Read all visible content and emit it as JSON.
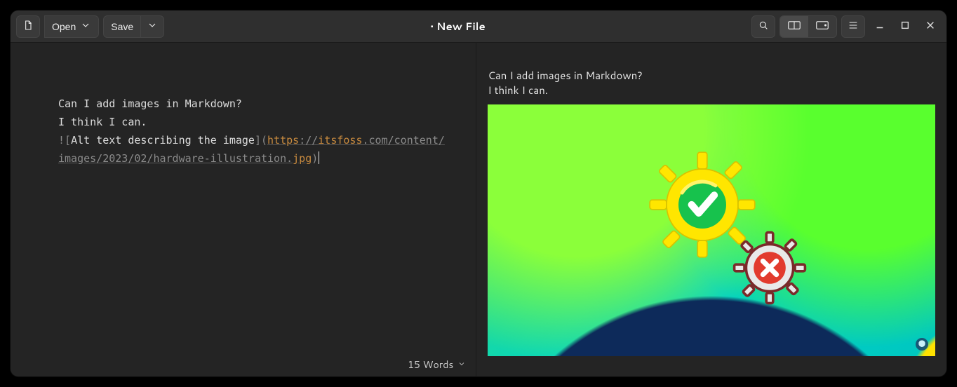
{
  "header": {
    "title": "• New File",
    "open_label": "Open",
    "save_label": "Save"
  },
  "editor": {
    "line1": "Can I add images in Markdown?",
    "line2": "I think I can.",
    "img_bang": "!",
    "img_lbracket": "[",
    "img_alt": "Alt text describing the image",
    "img_rbracket_lparen": "](",
    "url_scheme": "https",
    "url_sep1": "://",
    "url_host": "itsfoss",
    "url_rest1": ".com/content/",
    "url_rest2": "images/2023/02/hardware-illustration.",
    "url_ext": "jpg",
    "img_rparen": ")"
  },
  "status": {
    "word_count_label": "15 Words"
  },
  "preview": {
    "line1": "Can I add images in Markdown?",
    "line2": "I think I can.",
    "image_alt": "Alt text describing the image"
  },
  "icons": {
    "new_doc": "new-document-icon",
    "chevron_down": "chevron-down-icon",
    "search": "search-icon",
    "side_by_side": "side-by-side-icon",
    "preview_only": "preview-only-icon",
    "menu": "hamburger-menu-icon",
    "minimize": "window-minimize-icon",
    "maximize": "window-maximize-icon",
    "close": "window-close-icon"
  }
}
